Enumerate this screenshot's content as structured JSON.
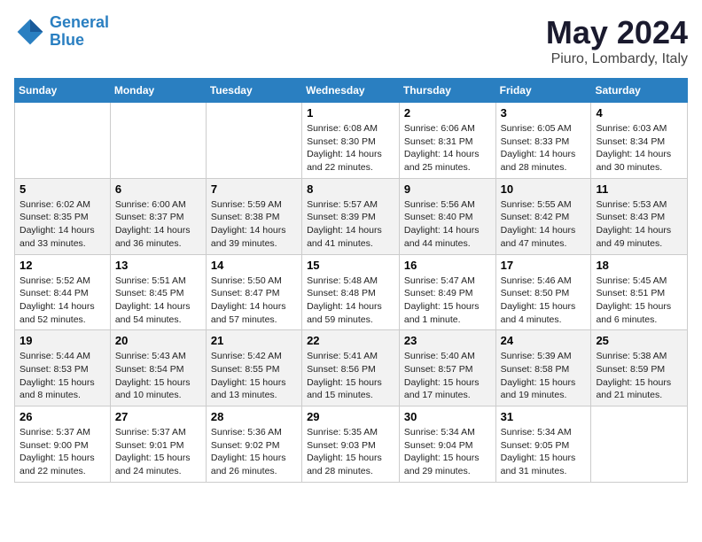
{
  "header": {
    "logo_general": "General",
    "logo_blue": "Blue",
    "month_title": "May 2024",
    "location": "Piuro, Lombardy, Italy"
  },
  "weekdays": [
    "Sunday",
    "Monday",
    "Tuesday",
    "Wednesday",
    "Thursday",
    "Friday",
    "Saturday"
  ],
  "weeks": [
    [
      {
        "day": "",
        "info": ""
      },
      {
        "day": "",
        "info": ""
      },
      {
        "day": "",
        "info": ""
      },
      {
        "day": "1",
        "info": "Sunrise: 6:08 AM\nSunset: 8:30 PM\nDaylight: 14 hours\nand 22 minutes."
      },
      {
        "day": "2",
        "info": "Sunrise: 6:06 AM\nSunset: 8:31 PM\nDaylight: 14 hours\nand 25 minutes."
      },
      {
        "day": "3",
        "info": "Sunrise: 6:05 AM\nSunset: 8:33 PM\nDaylight: 14 hours\nand 28 minutes."
      },
      {
        "day": "4",
        "info": "Sunrise: 6:03 AM\nSunset: 8:34 PM\nDaylight: 14 hours\nand 30 minutes."
      }
    ],
    [
      {
        "day": "5",
        "info": "Sunrise: 6:02 AM\nSunset: 8:35 PM\nDaylight: 14 hours\nand 33 minutes."
      },
      {
        "day": "6",
        "info": "Sunrise: 6:00 AM\nSunset: 8:37 PM\nDaylight: 14 hours\nand 36 minutes."
      },
      {
        "day": "7",
        "info": "Sunrise: 5:59 AM\nSunset: 8:38 PM\nDaylight: 14 hours\nand 39 minutes."
      },
      {
        "day": "8",
        "info": "Sunrise: 5:57 AM\nSunset: 8:39 PM\nDaylight: 14 hours\nand 41 minutes."
      },
      {
        "day": "9",
        "info": "Sunrise: 5:56 AM\nSunset: 8:40 PM\nDaylight: 14 hours\nand 44 minutes."
      },
      {
        "day": "10",
        "info": "Sunrise: 5:55 AM\nSunset: 8:42 PM\nDaylight: 14 hours\nand 47 minutes."
      },
      {
        "day": "11",
        "info": "Sunrise: 5:53 AM\nSunset: 8:43 PM\nDaylight: 14 hours\nand 49 minutes."
      }
    ],
    [
      {
        "day": "12",
        "info": "Sunrise: 5:52 AM\nSunset: 8:44 PM\nDaylight: 14 hours\nand 52 minutes."
      },
      {
        "day": "13",
        "info": "Sunrise: 5:51 AM\nSunset: 8:45 PM\nDaylight: 14 hours\nand 54 minutes."
      },
      {
        "day": "14",
        "info": "Sunrise: 5:50 AM\nSunset: 8:47 PM\nDaylight: 14 hours\nand 57 minutes."
      },
      {
        "day": "15",
        "info": "Sunrise: 5:48 AM\nSunset: 8:48 PM\nDaylight: 14 hours\nand 59 minutes."
      },
      {
        "day": "16",
        "info": "Sunrise: 5:47 AM\nSunset: 8:49 PM\nDaylight: 15 hours\nand 1 minute."
      },
      {
        "day": "17",
        "info": "Sunrise: 5:46 AM\nSunset: 8:50 PM\nDaylight: 15 hours\nand 4 minutes."
      },
      {
        "day": "18",
        "info": "Sunrise: 5:45 AM\nSunset: 8:51 PM\nDaylight: 15 hours\nand 6 minutes."
      }
    ],
    [
      {
        "day": "19",
        "info": "Sunrise: 5:44 AM\nSunset: 8:53 PM\nDaylight: 15 hours\nand 8 minutes."
      },
      {
        "day": "20",
        "info": "Sunrise: 5:43 AM\nSunset: 8:54 PM\nDaylight: 15 hours\nand 10 minutes."
      },
      {
        "day": "21",
        "info": "Sunrise: 5:42 AM\nSunset: 8:55 PM\nDaylight: 15 hours\nand 13 minutes."
      },
      {
        "day": "22",
        "info": "Sunrise: 5:41 AM\nSunset: 8:56 PM\nDaylight: 15 hours\nand 15 minutes."
      },
      {
        "day": "23",
        "info": "Sunrise: 5:40 AM\nSunset: 8:57 PM\nDaylight: 15 hours\nand 17 minutes."
      },
      {
        "day": "24",
        "info": "Sunrise: 5:39 AM\nSunset: 8:58 PM\nDaylight: 15 hours\nand 19 minutes."
      },
      {
        "day": "25",
        "info": "Sunrise: 5:38 AM\nSunset: 8:59 PM\nDaylight: 15 hours\nand 21 minutes."
      }
    ],
    [
      {
        "day": "26",
        "info": "Sunrise: 5:37 AM\nSunset: 9:00 PM\nDaylight: 15 hours\nand 22 minutes."
      },
      {
        "day": "27",
        "info": "Sunrise: 5:37 AM\nSunset: 9:01 PM\nDaylight: 15 hours\nand 24 minutes."
      },
      {
        "day": "28",
        "info": "Sunrise: 5:36 AM\nSunset: 9:02 PM\nDaylight: 15 hours\nand 26 minutes."
      },
      {
        "day": "29",
        "info": "Sunrise: 5:35 AM\nSunset: 9:03 PM\nDaylight: 15 hours\nand 28 minutes."
      },
      {
        "day": "30",
        "info": "Sunrise: 5:34 AM\nSunset: 9:04 PM\nDaylight: 15 hours\nand 29 minutes."
      },
      {
        "day": "31",
        "info": "Sunrise: 5:34 AM\nSunset: 9:05 PM\nDaylight: 15 hours\nand 31 minutes."
      },
      {
        "day": "",
        "info": ""
      }
    ]
  ]
}
